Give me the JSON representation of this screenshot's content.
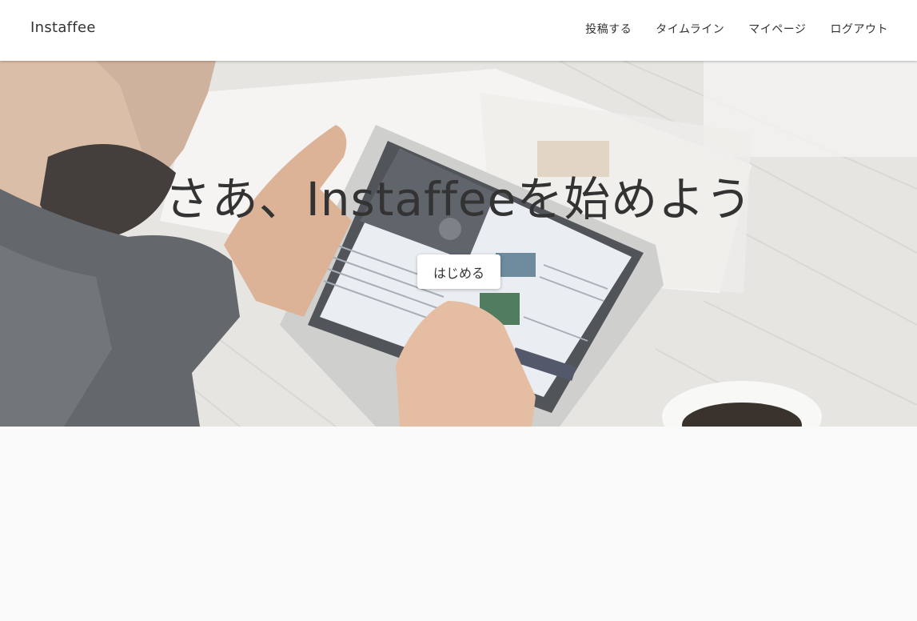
{
  "navbar": {
    "brand": "Instaffee",
    "links": [
      {
        "label": "投稿する"
      },
      {
        "label": "タイムライン"
      },
      {
        "label": "マイページ"
      },
      {
        "label": "ログアウト"
      }
    ]
  },
  "hero": {
    "title": "さあ、Instaffeeを始めよう",
    "button_label": "はじめる"
  },
  "colors": {
    "navbar_bg": "#ffffff",
    "text": "#333333",
    "page_bg": "#fafafa"
  }
}
